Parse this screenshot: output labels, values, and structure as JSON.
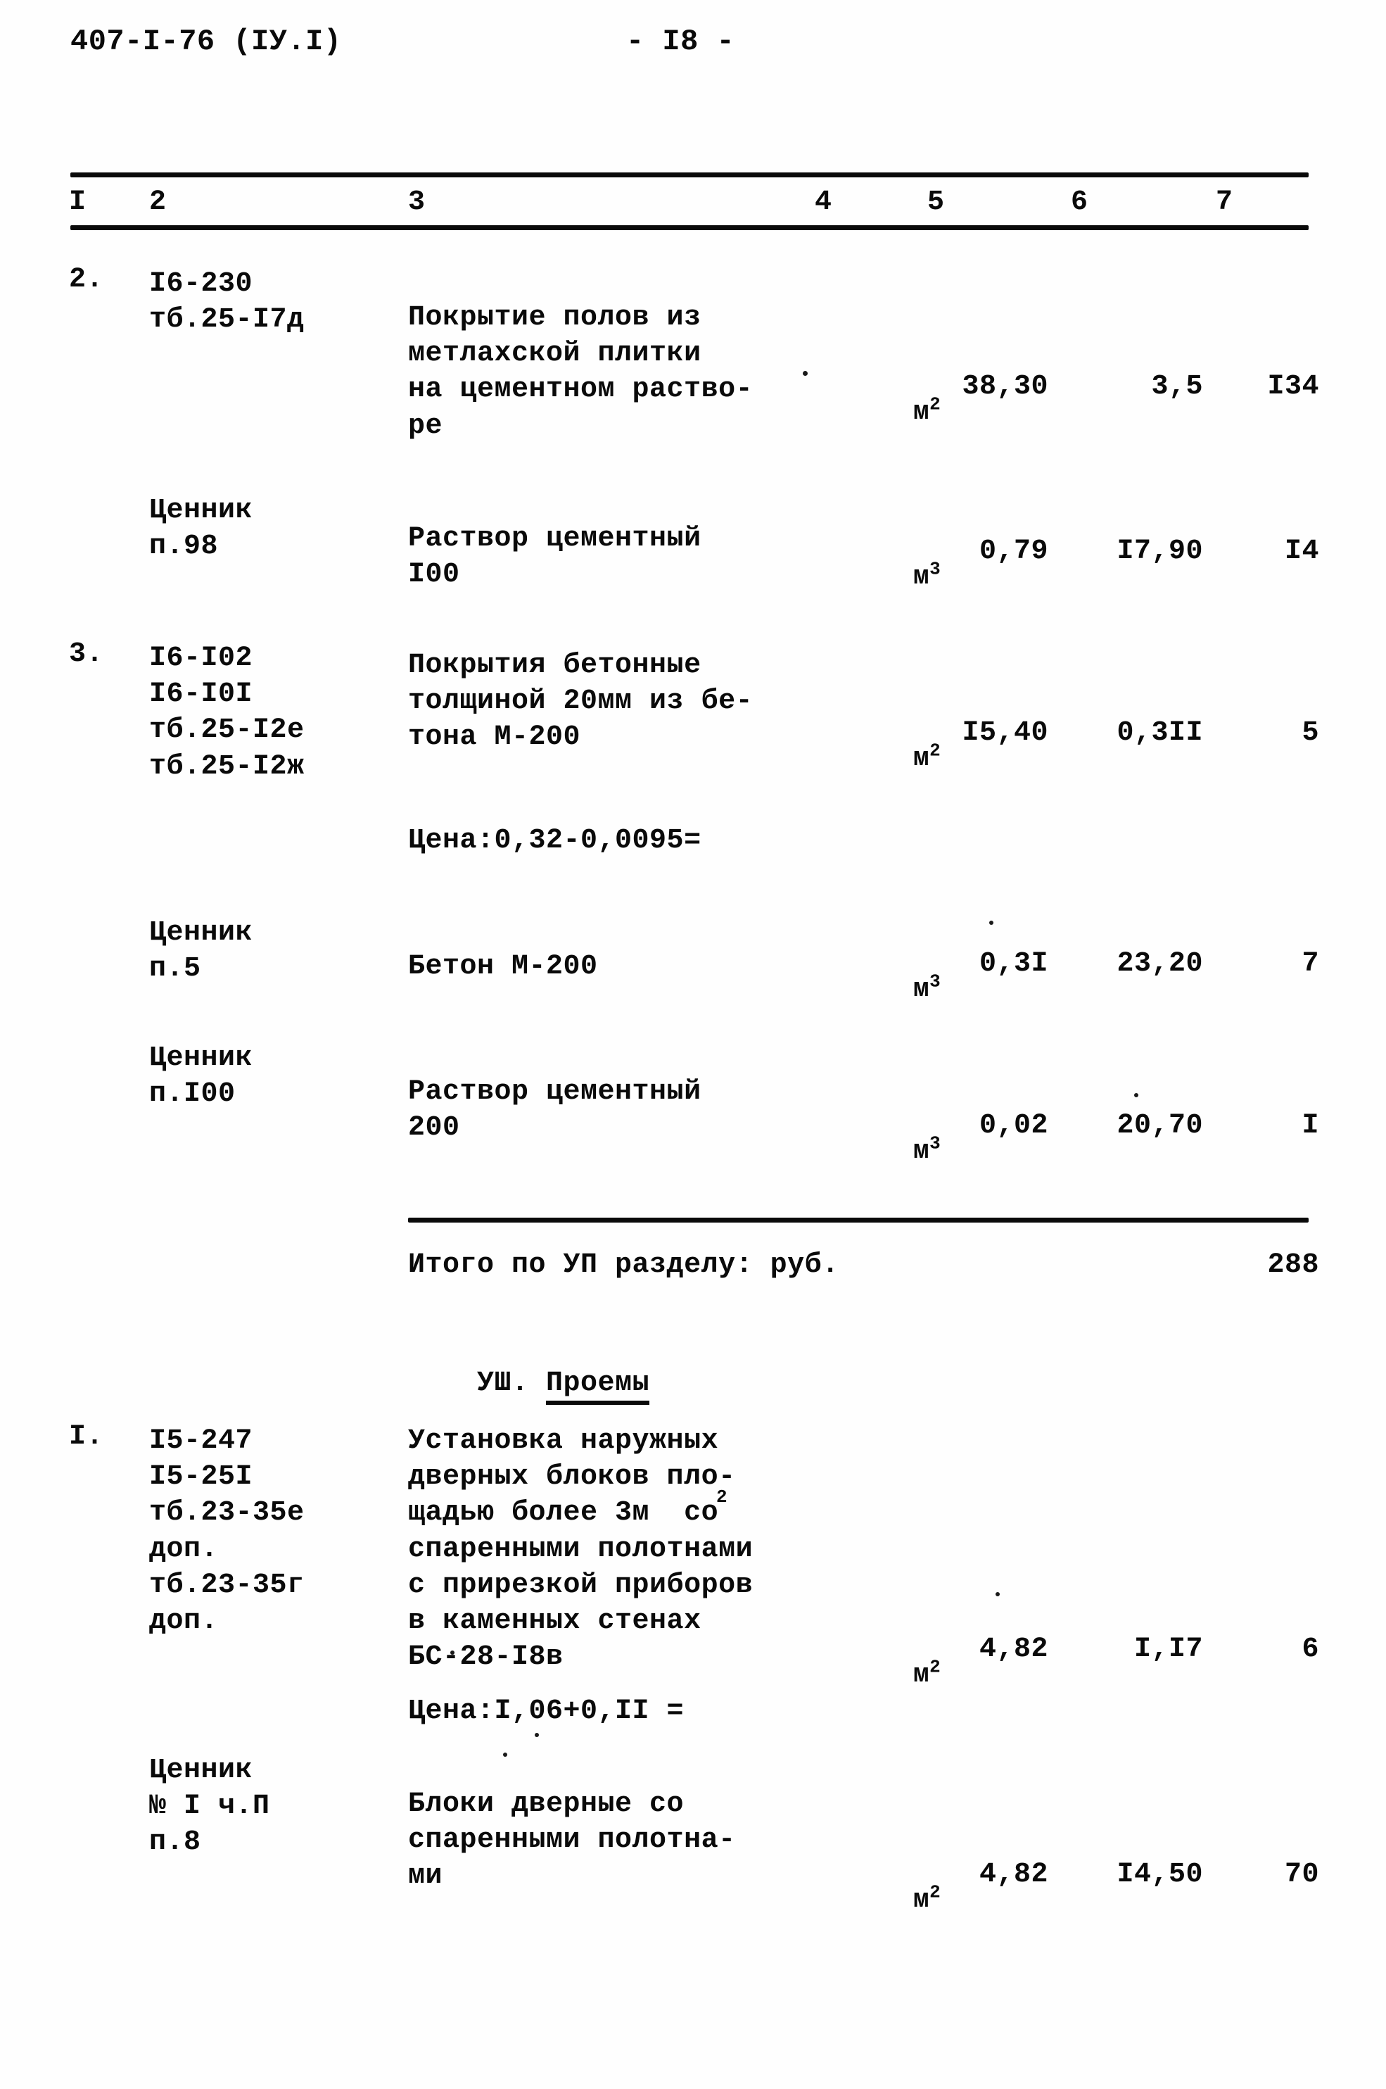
{
  "header": {
    "document_code": "407-I-76 (IУ.I)",
    "page_label": "- I8 -"
  },
  "table": {
    "column_headers": [
      "I",
      "2",
      "3",
      "4",
      "5",
      "6",
      "7"
    ],
    "rows": [
      {
        "no": "2.",
        "codes": "I6-230\nтб.25-I7д",
        "description": "Покрытие полов из\nметлахской плитки\nна цементном раство-\nре",
        "unit_base": "м",
        "unit_sup": "2",
        "qty": "38,30",
        "price": "3,5",
        "total": "I34"
      },
      {
        "no": "",
        "codes": "Ценник\nп.98",
        "description": "Раствор цементный\nI00",
        "unit_base": "м",
        "unit_sup": "3",
        "qty": "0,79",
        "price": "I7,90",
        "total": "I4"
      },
      {
        "no": "3.",
        "codes": "I6-I02\nI6-I0I\nтб.25-I2e\nтб.25-I2ж",
        "description": "Покрытия бетонные\nтолщиной 20мм из бе-\nтона М-200",
        "unit_base": "м",
        "unit_sup": "2",
        "qty": "I5,40",
        "price": "0,3II",
        "total": "5"
      },
      {
        "no": "",
        "codes": "Ценник\nп.5",
        "description": "Бетон М-200",
        "unit_base": "м",
        "unit_sup": "3",
        "qty": "0,3I",
        "price": "23,20",
        "total": "7"
      },
      {
        "no": "",
        "codes": "Ценник\nп.I00",
        "description": "Раствор цементный\n200",
        "unit_base": "м",
        "unit_sup": "3",
        "qty": "0,02",
        "price": "20,70",
        "total": "I"
      },
      {
        "no": "I.",
        "codes": "I5-247\nI5-25I\nтб.23-35е\nдоп.\nтб.23-35г\nдоп.",
        "description": "Установка наружных\nдверных блоков пло-\nщадью более 3м  со\nспаренными полотнами\nс прирезкой приборов\nв каменных стенах\nБС-28-I8в",
        "unit_base": "м",
        "unit_sup": "2",
        "qty": "4,82",
        "price": "I,I7",
        "total": "6"
      },
      {
        "no": "",
        "codes": "Ценник\n№ I ч.П\nп.8",
        "description": "Блоки дверные со\nспаренными полотна-\nми",
        "unit_base": "м",
        "unit_sup": "2",
        "qty": "4,82",
        "price": "I4,50",
        "total": "70"
      }
    ],
    "notes": {
      "price_note_1": "Цена:0,32-0,0095=",
      "price_note_2": "Цена:I,06+0,II ="
    },
    "totals": {
      "label": "Итого по УП разделу: руб.",
      "value": "288"
    },
    "section_heading": {
      "number": "УШ.",
      "title": "Проемы"
    },
    "inline_superscripts": {
      "area_sup": "2"
    }
  }
}
